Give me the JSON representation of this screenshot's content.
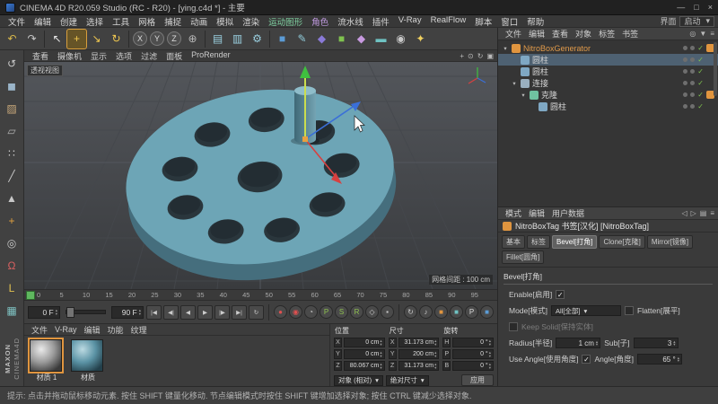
{
  "ui": {
    "caret": "▾",
    "spin_up": "▴",
    "spin_down": "▾",
    "check": "✓"
  },
  "titlebar": {
    "title": "CINEMA 4D R20.059 Studio (RC - R20) - [ying.c4d *] - 主要",
    "min": "—",
    "max": "□",
    "close": "×"
  },
  "menubar": {
    "items": [
      {
        "label": "文件"
      },
      {
        "label": "编辑"
      },
      {
        "label": "创建"
      },
      {
        "label": "选择"
      },
      {
        "label": "工具"
      },
      {
        "label": "网格"
      },
      {
        "label": "捕捉"
      },
      {
        "label": "动画"
      },
      {
        "label": "模拟"
      },
      {
        "label": "渲染"
      },
      {
        "label": "运动图形",
        "color": "#7fd0a0"
      },
      {
        "label": "角色",
        "color": "#c09ae0"
      },
      {
        "label": "流水线"
      },
      {
        "label": "插件"
      },
      {
        "label": "V-Ray"
      },
      {
        "label": "RealFlow"
      },
      {
        "label": "脚本"
      },
      {
        "label": "窗口"
      },
      {
        "label": "帮助"
      }
    ],
    "right_label": "界面",
    "right_value": "启动"
  },
  "toolbar": {
    "icons": [
      {
        "name": "undo-button",
        "glyph": "↶",
        "color": "#d8b84a"
      },
      {
        "name": "redo-button",
        "glyph": "↷",
        "color": "#c8c8c8"
      },
      {
        "cls": "sep"
      },
      {
        "name": "live-selection-tool",
        "glyph": "↖",
        "color": "#e8e8e8"
      },
      {
        "name": "move-tool",
        "glyph": "+",
        "color": "#f0c850",
        "active": true
      },
      {
        "name": "scale-tool",
        "glyph": "↘",
        "color": "#f0c850"
      },
      {
        "name": "rotate-tool",
        "glyph": "↻",
        "color": "#f0c850"
      },
      {
        "cls": "sep"
      },
      {
        "name": "x-axis-lock",
        "glyph": "X",
        "cls": "circle"
      },
      {
        "name": "y-axis-lock",
        "glyph": "Y",
        "cls": "circle"
      },
      {
        "name": "z-axis-lock",
        "glyph": "Z",
        "cls": "circle"
      },
      {
        "name": "coordinate-system-toggle",
        "glyph": "⊕",
        "color": "#b8b8b8"
      },
      {
        "cls": "sep"
      },
      {
        "name": "render-view-button",
        "glyph": "▤",
        "color": "#9ad0e0"
      },
      {
        "name": "render-picture-viewer-button",
        "glyph": "▥",
        "color": "#9ad0e0"
      },
      {
        "name": "render-settings-button",
        "glyph": "⚙",
        "color": "#9ad0e0"
      },
      {
        "cls": "sep"
      },
      {
        "name": "add-primitive-button",
        "glyph": "■",
        "color": "#5b9bd5"
      },
      {
        "name": "add-spline-button",
        "glyph": "✎",
        "color": "#8fc9d8"
      },
      {
        "name": "add-generator-button",
        "glyph": "◆",
        "color": "#8a7ad8"
      },
      {
        "name": "add-mograph-button",
        "glyph": "■",
        "color": "#7fc24f"
      },
      {
        "name": "add-deformer-button",
        "glyph": "◆",
        "color": "#c89ae0"
      },
      {
        "name": "add-environment-button",
        "glyph": "▬",
        "color": "#6fc2c2"
      },
      {
        "name": "add-camera-button",
        "glyph": "◉",
        "color": "#c8c8c8"
      },
      {
        "name": "add-light-button",
        "glyph": "✦",
        "color": "#f0d060"
      }
    ]
  },
  "left_toolbar": {
    "icons": [
      {
        "name": "make-editable-icon",
        "glyph": "↺",
        "color": "#c8c8c8"
      },
      {
        "name": "model-mode-icon",
        "glyph": "◼",
        "color": "#9ab4c8"
      },
      {
        "name": "texture-mode-icon",
        "glyph": "▨",
        "color": "#c8a87a"
      },
      {
        "name": "workplane-mode-icon",
        "glyph": "▱",
        "color": "#b0b0b0"
      },
      {
        "name": "points-mode-icon",
        "glyph": "∷",
        "color": "#c8c8c8"
      },
      {
        "name": "edges-mode-icon",
        "glyph": "╱",
        "color": "#c8c8c8"
      },
      {
        "name": "polygons-mode-icon",
        "glyph": "▲",
        "color": "#c8c8c8"
      },
      {
        "name": "enable-axis-icon",
        "glyph": "+",
        "color": "#e0a040"
      },
      {
        "name": "viewport-solo-icon",
        "glyph": "◎",
        "color": "#c8c8c8"
      },
      {
        "name": "enable-snap-icon",
        "glyph": "Ω",
        "color": "#d86060"
      },
      {
        "name": "locked-workplane-icon",
        "glyph": "L",
        "color": "#e0c050"
      },
      {
        "name": "quantize-icon",
        "glyph": "▦",
        "color": "#7fc2c2"
      }
    ]
  },
  "viewport": {
    "menus": [
      "查看",
      "摄像机",
      "显示",
      "选项",
      "过滤",
      "面板",
      "ProRender"
    ],
    "nav_icons": [
      {
        "name": "pan-view-icon",
        "glyph": "+"
      },
      {
        "name": "zoom-view-icon",
        "glyph": "⊙"
      },
      {
        "name": "rotate-view-icon",
        "glyph": "↻"
      },
      {
        "name": "toggle-views-icon",
        "glyph": "▣"
      }
    ],
    "view_label": "透视视图",
    "grid_label": "网格间距 : 100 cm"
  },
  "timeline": {
    "ticks": [
      "0",
      "5",
      "10",
      "15",
      "20",
      "25",
      "30",
      "35",
      "40",
      "45",
      "50",
      "55",
      "60",
      "65",
      "70",
      "75",
      "80",
      "85",
      "90",
      "95"
    ],
    "start_frame": "0 F",
    "end_frame": "90 F"
  },
  "transport": {
    "buttons": [
      {
        "name": "goto-start-button",
        "glyph": "|◀"
      },
      {
        "name": "prev-key-button",
        "glyph": "◀|"
      },
      {
        "name": "prev-frame-button",
        "glyph": "◀"
      },
      {
        "name": "play-button",
        "glyph": "▶"
      },
      {
        "name": "next-key-button",
        "glyph": "|▶"
      },
      {
        "name": "goto-end-button",
        "glyph": "▶|"
      },
      {
        "name": "loop-button",
        "glyph": "↻"
      }
    ]
  },
  "keys": {
    "buttons": [
      {
        "name": "record-keyframe-button",
        "glyph": "●",
        "color": "#e05050"
      },
      {
        "name": "autokeying-button",
        "glyph": "◉",
        "color": "#e05050"
      },
      {
        "name": "keyframe-selection-button",
        "glyph": "◔",
        "color": "#cccccc"
      },
      {
        "name": "key-position-toggle",
        "glyph": "P",
        "color": "#8fc24f"
      },
      {
        "name": "key-scale-toggle",
        "glyph": "S",
        "color": "#8fc24f"
      },
      {
        "name": "key-rotation-toggle",
        "glyph": "R",
        "color": "#8fc24f"
      },
      {
        "name": "key-parameter-toggle",
        "glyph": "◇",
        "color": "#cccccc"
      },
      {
        "name": "key-pla-toggle",
        "glyph": "▪",
        "color": "#cccccc"
      }
    ]
  },
  "extra_buttons": {
    "buttons": [
      {
        "name": "playback-mode-button",
        "glyph": "↻",
        "color": "#cccccc"
      },
      {
        "name": "sound-toggle-button",
        "glyph": "♪",
        "color": "#cccccc"
      },
      {
        "name": "quick-orange-button",
        "glyph": "■",
        "color": "#e0953f"
      },
      {
        "name": "quick-teal-button",
        "glyph": "■",
        "color": "#6fc2c2"
      },
      {
        "name": "quick-p-button",
        "glyph": "P",
        "color": "#dddddd"
      },
      {
        "name": "quick-blue-button",
        "glyph": "■",
        "color": "#5b9bd5"
      }
    ]
  },
  "materials": {
    "menus": [
      "文件",
      "V-Ray",
      "编辑",
      "功能",
      "纹理"
    ],
    "items": [
      {
        "label": "材质 1"
      },
      {
        "label": "材质"
      }
    ]
  },
  "coordinates": {
    "headers": [
      "位置",
      "尺寸",
      "旋转"
    ],
    "position": [
      {
        "axis": "X",
        "value": "0 cm"
      },
      {
        "axis": "Y",
        "value": "0 cm"
      },
      {
        "axis": "Z",
        "value": "80.067 cm"
      }
    ],
    "size": [
      {
        "axis": "X",
        "value": "31.173 cm"
      },
      {
        "axis": "Y",
        "value": "200 cm"
      },
      {
        "axis": "Z",
        "value": "31.173 cm"
      }
    ],
    "rotation": [
      {
        "axis": "H",
        "value": "0 °"
      },
      {
        "axis": "P",
        "value": "0 °"
      },
      {
        "axis": "B",
        "value": "0 °"
      }
    ],
    "mode": "对象 (相对)",
    "size_mode": "绝对尺寸",
    "apply_label": "应用"
  },
  "object_manager": {
    "menus": [
      "文件",
      "编辑",
      "查看",
      "对象",
      "标签",
      "书签"
    ],
    "right_icons": [
      {
        "name": "om-search-icon",
        "glyph": "◎"
      },
      {
        "name": "om-filter-icon",
        "glyph": "▼"
      },
      {
        "name": "om-menu-icon",
        "glyph": "≡"
      }
    ],
    "check_glyph": "✓",
    "rows": [
      {
        "name": "tree-item-nitroboxgenerator",
        "exp": "▾",
        "label": "NitroBoxGenerator",
        "color": "#e09a4a",
        "icon": "#e0953f",
        "indent": 0,
        "tag": "#e0953f"
      },
      {
        "name": "tree-item-cylinder-1",
        "exp": "",
        "label": "圆柱",
        "icon": "#7fa8c4",
        "indent": 1,
        "selected": true
      },
      {
        "name": "tree-item-cylinder-2",
        "exp": "",
        "label": "圆柱",
        "icon": "#7fa8c4",
        "indent": 1
      },
      {
        "name": "tree-item-connect",
        "exp": "▾",
        "label": "连接",
        "icon": "#9ab0c0",
        "indent": 1
      },
      {
        "name": "tree-item-cloner",
        "exp": "▾",
        "label": "克隆",
        "icon": "#6fc2a0",
        "indent": 2,
        "tag": "#e0953f"
      },
      {
        "name": "tree-item-cylinder-3",
        "exp": "",
        "label": "圆柱",
        "icon": "#7fa8c4",
        "indent": 3
      }
    ]
  },
  "attributes": {
    "menus": [
      "模式",
      "编辑",
      "用户数据"
    ],
    "right_icons": [
      {
        "name": "attr-back-icon",
        "glyph": "◁"
      },
      {
        "name": "attr-forward-icon",
        "glyph": "▷"
      },
      {
        "name": "attr-pin-icon",
        "glyph": "▤"
      },
      {
        "name": "attr-menu-icon",
        "glyph": "≡"
      }
    ],
    "title": "NitroBoxTag 书签[汉化] [NitroBoxTag]",
    "tabs": [
      {
        "label": "基本"
      },
      {
        "label": "标签"
      },
      {
        "label": "Bevel[打角]",
        "active": true
      },
      {
        "label": "Clone[克隆]"
      },
      {
        "label": "Mirror[镜像]"
      },
      {
        "label": "Fillet[圆角]"
      }
    ],
    "section": "Bevel[打角]",
    "enable_label": "Enable[启用]",
    "mode_label": "Mode[模式]",
    "mode_value": "All[全部]",
    "flatten_label": "Flatten[展平]",
    "keep_label": "Keep Solid[保持实体]",
    "radius_label": "Radius[半径]",
    "radius_value": "1 cm",
    "sub_label": "Sub[子]",
    "sub_value": "3",
    "use_angle_label": "Use Angle[使用角度]",
    "angle_label": "Angle[角度]",
    "angle_value": "65 °"
  },
  "branding": {
    "line1": "MAXON",
    "line2": "CINEMA4D"
  },
  "statusbar": {
    "text": "提示: 点击并拖动鼠标移动元素. 按住 SHIFT 键量化移动. 节点编辑模式时按住 SHIFT 键增加选择对象; 按住 CTRL 键减少选择对象."
  }
}
